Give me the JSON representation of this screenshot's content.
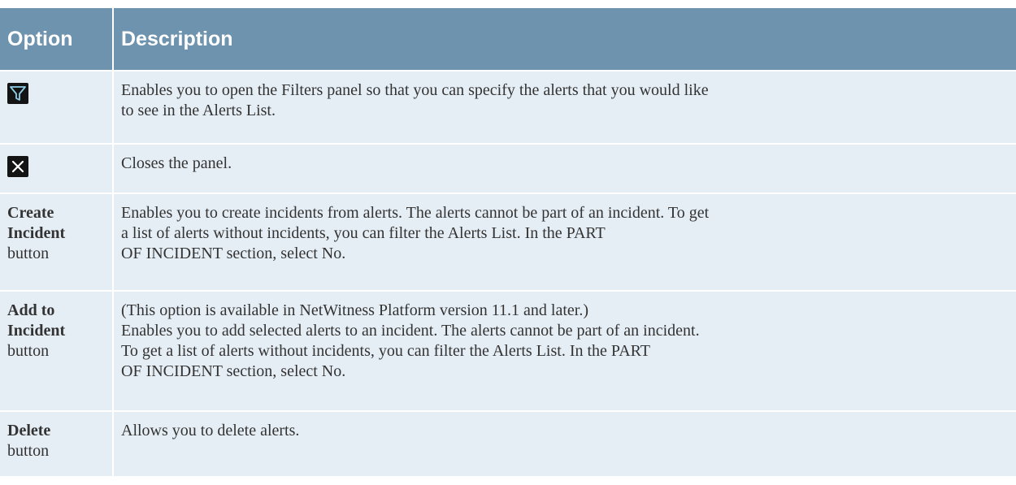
{
  "headers": {
    "option": "Option",
    "description": "Description"
  },
  "rows": [
    {
      "icon": "filter-icon",
      "description_lines": [
        "Enables you to open the Filters panel so that you can specify the alerts that you would like",
        "to see in the Alerts List."
      ]
    },
    {
      "icon": "close-icon",
      "description_lines": [
        "Closes the panel."
      ]
    },
    {
      "option_name": [
        "Create",
        "Incident"
      ],
      "option_suffix": "button",
      "description_lines": [
        "Enables you to create incidents from alerts. The alerts cannot be part of an incident. To get",
        "a list of alerts without incidents, you can filter the Alerts List. In the PART",
        "OF INCIDENT section, select No."
      ]
    },
    {
      "option_name": [
        "Add to",
        "Incident"
      ],
      "option_suffix": "button",
      "description_lines": [
        "(This option is available in NetWitness Platform version 11.1 and later.)",
        "Enables you to add selected alerts to an incident. The alerts cannot be part of an incident.",
        "To get a list of alerts without incidents, you can filter the Alerts List. In the PART",
        "OF INCIDENT section, select No."
      ]
    },
    {
      "option_name": [
        "Delete"
      ],
      "option_suffix": "button",
      "description_lines": [
        "Allows you to delete alerts."
      ]
    }
  ],
  "colors": {
    "header_bg": "#6e93ae",
    "row_bg": "#e6eef5",
    "icon_bg": "#141414"
  }
}
